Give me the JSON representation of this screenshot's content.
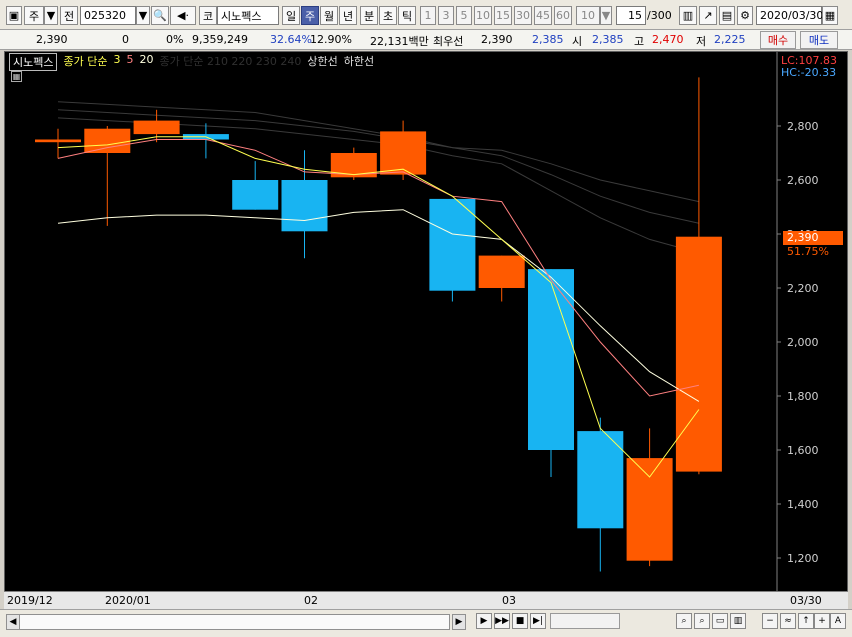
{
  "toolbar": {
    "period_select": "주",
    "prev_label": "전",
    "code": "025320",
    "market_btn": "코",
    "name": "시노펙스",
    "period_tabs": [
      "일",
      "주",
      "월",
      "년",
      "분",
      "초",
      "틱"
    ],
    "interval_buttons": [
      "1",
      "3",
      "5",
      "10",
      "15",
      "30",
      "45",
      "60"
    ],
    "count_select": "10",
    "page_value": "15",
    "page_total": "/300",
    "date": "2020/03/30"
  },
  "quote": {
    "price": "2,390",
    "change": "0",
    "change_pct": "0%",
    "volume": "9,359,249",
    "ratio1": "32.64%",
    "ratio2": "12.90%",
    "amount": "22,131백만",
    "priority_label": "최우선",
    "priority_value": "2,390",
    "ask": "2,385",
    "open_label": "시",
    "open": "2,385",
    "high_label": "고",
    "high": "2,470",
    "low_label": "저",
    "low": "2,225",
    "buy_label": "매수",
    "sell_label": "매도"
  },
  "legend": {
    "name": "시노펙스",
    "ma_title": "종가 단순",
    "ma_periods": [
      "3",
      "5",
      "20"
    ],
    "ma2_title": "종가 단순 210 220 230 240",
    "upper_limit": "상한선",
    "lower_limit": "하한선"
  },
  "overlay": {
    "lc": "LC:107.83",
    "hc": "HC:-20.33",
    "price_tag": "2,390",
    "pct_tag": "51.75%"
  },
  "colors": {
    "up": "#ff5a00",
    "down": "#18b4f2",
    "ma3": "#ffff50",
    "ma5": "#ff8080",
    "ma20": "#ffffe0"
  },
  "chart_data": {
    "type": "candlestick",
    "y_ticks": [
      "2,800",
      "2,600",
      "2,400",
      "2,200",
      "2,000",
      "1,800",
      "1,600",
      "1,400",
      "1,200"
    ],
    "x_labels": [
      "2019/12",
      "2020/01",
      "02",
      "03",
      "03/30"
    ],
    "ylim": [
      1100,
      3000
    ],
    "candles": [
      {
        "o": 2740,
        "h": 2790,
        "l": 2680,
        "c": 2750
      },
      {
        "o": 2700,
        "h": 2800,
        "l": 2430,
        "c": 2790
      },
      {
        "o": 2770,
        "h": 2860,
        "l": 2740,
        "c": 2820
      },
      {
        "o": 2770,
        "h": 2810,
        "l": 2680,
        "c": 2750
      },
      {
        "o": 2600,
        "h": 2670,
        "l": 2490,
        "c": 2490
      },
      {
        "o": 2600,
        "h": 2710,
        "l": 2310,
        "c": 2410
      },
      {
        "o": 2610,
        "h": 2720,
        "l": 2600,
        "c": 2700
      },
      {
        "o": 2620,
        "h": 2820,
        "l": 2600,
        "c": 2780
      },
      {
        "o": 2530,
        "h": 2530,
        "l": 2150,
        "c": 2190
      },
      {
        "o": 2200,
        "h": 2320,
        "l": 2150,
        "c": 2320
      },
      {
        "o": 2270,
        "h": 2270,
        "l": 1500,
        "c": 1600
      },
      {
        "o": 1670,
        "h": 1720,
        "l": 1150,
        "c": 1310
      },
      {
        "o": 1190,
        "h": 1680,
        "l": 1170,
        "c": 1570
      },
      {
        "o": 1520,
        "h": 2980,
        "l": 1510,
        "c": 2390
      }
    ],
    "ma3": [
      2720,
      2730,
      2760,
      2760,
      2680,
      2640,
      2620,
      2640,
      2540,
      2380,
      2220,
      1680,
      1500,
      1750
    ],
    "ma5": [
      2680,
      2720,
      2750,
      2750,
      2710,
      2630,
      2620,
      2630,
      2540,
      2520,
      2230,
      2000,
      1800,
      1840
    ],
    "ma20": [
      2440,
      2460,
      2470,
      2470,
      2460,
      2450,
      2480,
      2490,
      2400,
      2380,
      2240,
      2060,
      1890,
      1780
    ],
    "long_mas": [
      [
        2890,
        2880,
        2870,
        2860,
        2850,
        2820,
        2790,
        2760,
        2720,
        2710,
        2660,
        2600,
        2560,
        2520
      ],
      [
        2860,
        2850,
        2840,
        2830,
        2820,
        2800,
        2780,
        2750,
        2720,
        2690,
        2620,
        2540,
        2480,
        2440
      ],
      [
        2830,
        2820,
        2810,
        2800,
        2790,
        2770,
        2750,
        2730,
        2690,
        2660,
        2560,
        2460,
        2380,
        2330
      ]
    ]
  }
}
